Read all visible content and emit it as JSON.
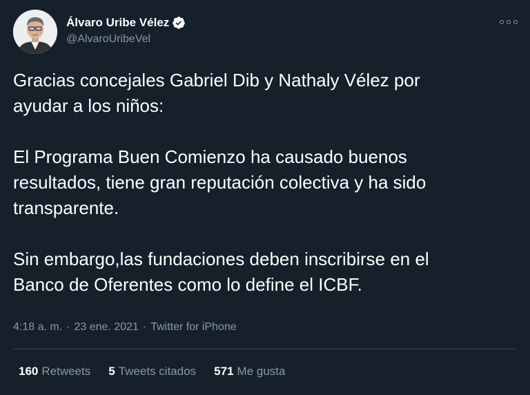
{
  "author": {
    "name": "Álvaro Uribe Vélez",
    "handle": "@AlvaroUribeVel",
    "verified": true,
    "avatar_icon": "profile-photo"
  },
  "tweet": {
    "text": "Gracias concejales Gabriel Dib y Nathaly Vélez por\nayudar a los niños:\n\nEl Programa Buen Comienzo ha causado buenos\nresultados, tiene gran reputación colectiva y ha sido\ntransparente.\n\nSin embargo,las fundaciones deben inscribirse en el\nBanco de Oferentes como lo define el ICBF."
  },
  "meta": {
    "time": "4:18 a. m.",
    "separator": "·",
    "date": "23 ene. 2021",
    "source": "Twitter for iPhone"
  },
  "stats": [
    {
      "count": "160",
      "label": "Retweets"
    },
    {
      "count": "5",
      "label": "Tweets citados"
    },
    {
      "count": "571",
      "label": "Me gusta"
    }
  ],
  "colors": {
    "background": "#15202b",
    "text_primary": "#ffffff",
    "text_secondary": "#8899a6",
    "divider": "#38444d",
    "verified_badge": "#ffffff"
  }
}
